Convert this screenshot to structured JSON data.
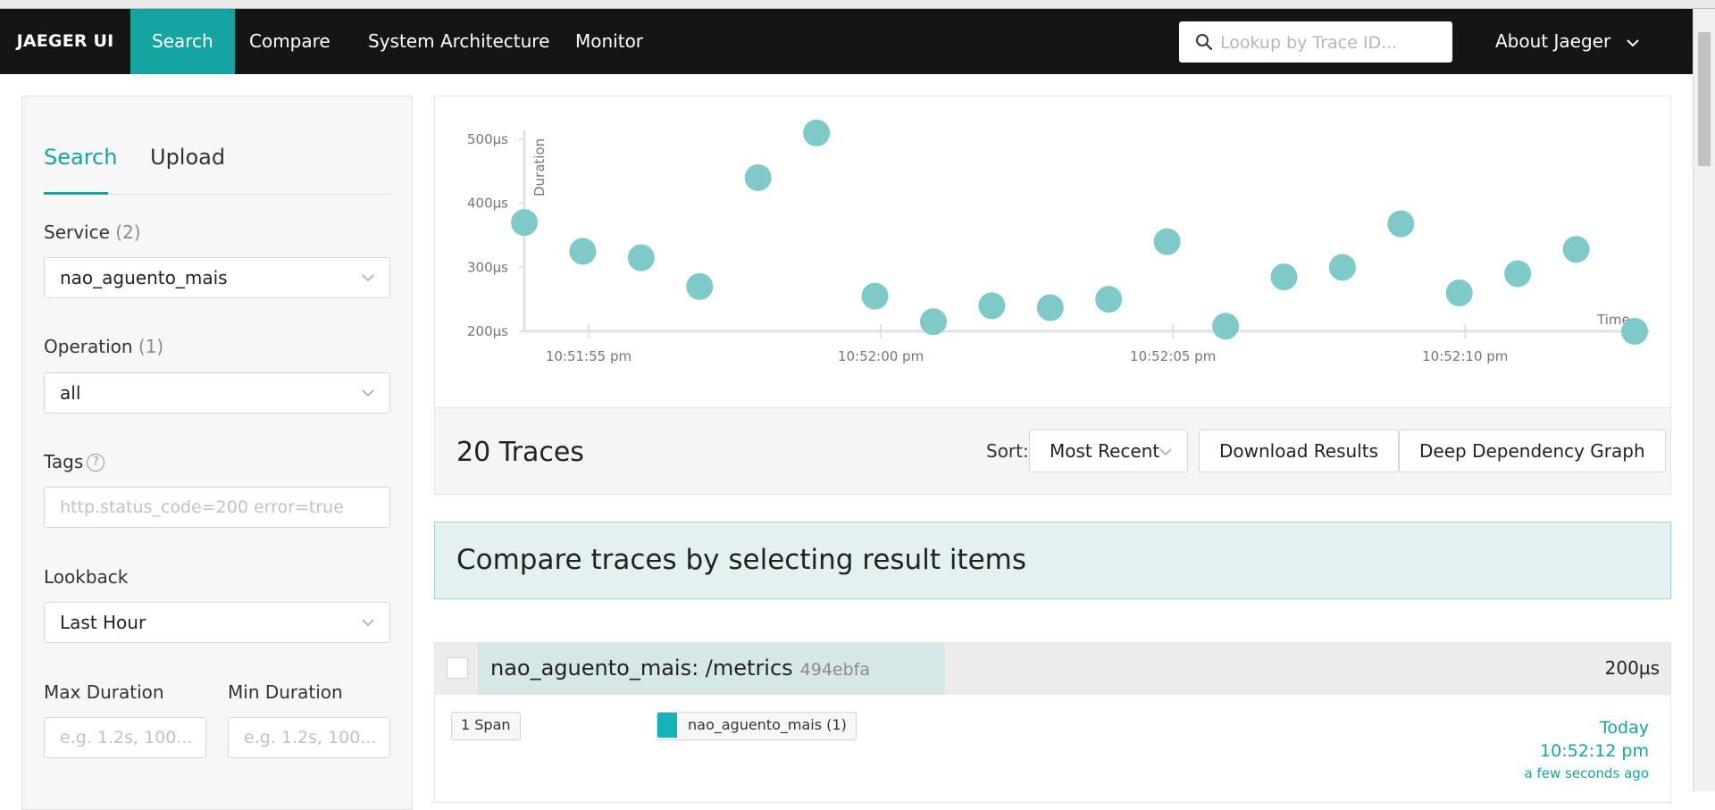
{
  "nav": {
    "brand": "JAEGER UI",
    "items": [
      "Search",
      "Compare",
      "System Architecture",
      "Monitor"
    ],
    "lookup_placeholder": "Lookup by Trace ID...",
    "about": "About Jaeger"
  },
  "search_panel": {
    "tabs": [
      "Search",
      "Upload"
    ],
    "service": {
      "label": "Service",
      "count": "(2)",
      "value": "nao_aguento_mais"
    },
    "operation": {
      "label": "Operation",
      "count": "(1)",
      "value": "all"
    },
    "tags": {
      "label": "Tags",
      "help": "?",
      "placeholder": "http.status_code=200 error=true"
    },
    "lookback": {
      "label": "Lookback",
      "value": "Last Hour"
    },
    "max_duration": {
      "label": "Max Duration",
      "placeholder": "e.g. 1.2s, 100..."
    },
    "min_duration": {
      "label": "Min Duration",
      "placeholder": "e.g. 1.2s, 100..."
    }
  },
  "chart_data": {
    "type": "scatter",
    "xlabel": "Time",
    "ylabel": "Duration",
    "y_ticks": [
      "200µs",
      "300µs",
      "400µs",
      "500µs"
    ],
    "x_ticks": [
      "10:51:55 pm",
      "10:52:00 pm",
      "10:52:05 pm",
      "10:52:10 pm"
    ],
    "points": [
      {
        "t": 53.9,
        "y": 370
      },
      {
        "t": 54.9,
        "y": 325
      },
      {
        "t": 55.9,
        "y": 315
      },
      {
        "t": 56.9,
        "y": 270
      },
      {
        "t": 57.9,
        "y": 440
      },
      {
        "t": 58.9,
        "y": 510
      },
      {
        "t": 59.9,
        "y": 255
      },
      {
        "t": 60.9,
        "y": 215
      },
      {
        "t": 61.9,
        "y": 240
      },
      {
        "t": 62.9,
        "y": 237
      },
      {
        "t": 63.9,
        "y": 250
      },
      {
        "t": 64.9,
        "y": 340
      },
      {
        "t": 65.9,
        "y": 208
      },
      {
        "t": 66.9,
        "y": 285
      },
      {
        "t": 67.9,
        "y": 300
      },
      {
        "t": 68.9,
        "y": 368
      },
      {
        "t": 69.9,
        "y": 260
      },
      {
        "t": 70.9,
        "y": 290
      },
      {
        "t": 71.9,
        "y": 328
      },
      {
        "t": 72.9,
        "y": 200
      }
    ],
    "point_color": "#7fcac9"
  },
  "results": {
    "count_label": "20 Traces",
    "sort_label": "Sort:",
    "sort_value": "Most Recent",
    "download_label": "Download Results",
    "ddg_label": "Deep Dependency Graph",
    "compare_banner": "Compare traces by selecting result items",
    "items": [
      {
        "title": "nao_aguento_mais: /metrics",
        "trace_id": "494ebfa",
        "duration": "200µs",
        "span_count": "1 Span",
        "service_badge": "nao_aguento_mais (1)",
        "date": "Today",
        "time": "10:52:12 pm",
        "relative": "a few seconds ago"
      }
    ]
  },
  "colors": {
    "accent": "#16a4a2",
    "nav_bg": "#151515",
    "service_swatch": "#16b2b7"
  }
}
